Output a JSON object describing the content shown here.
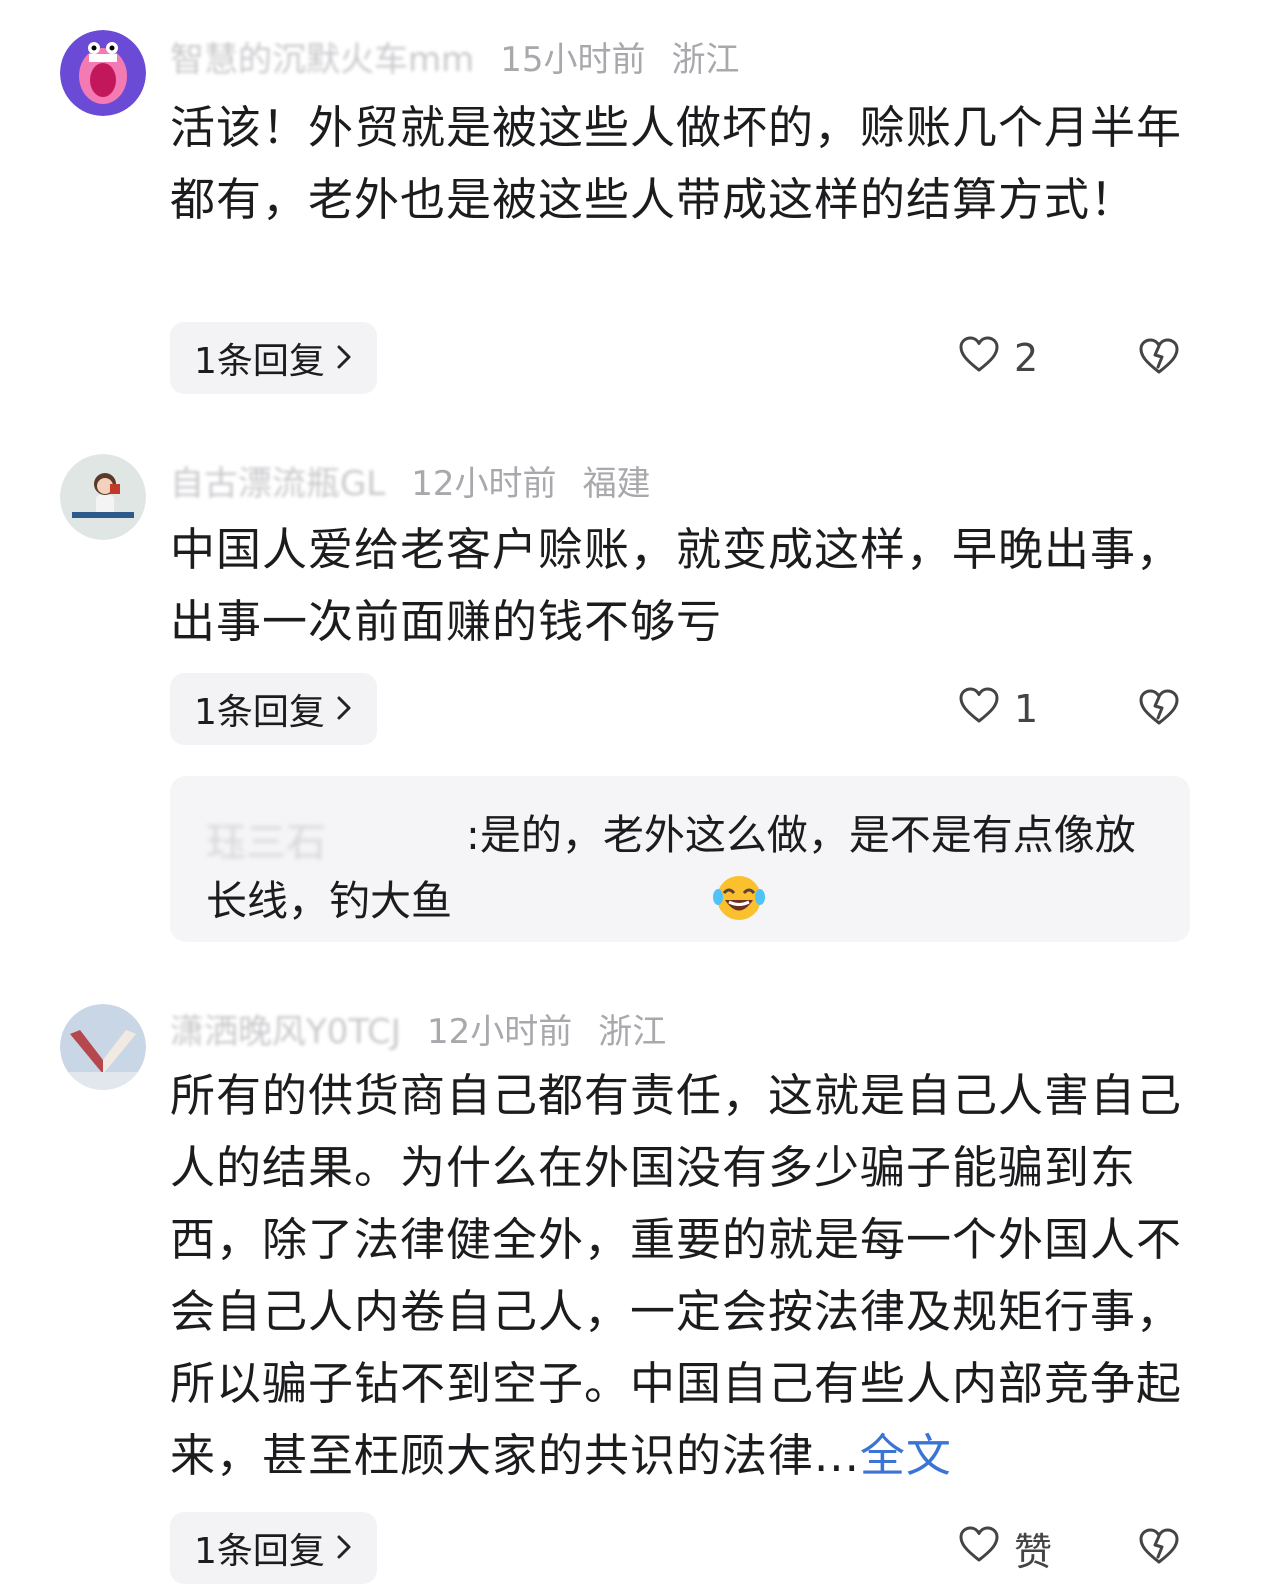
{
  "comments": [
    {
      "author": "智慧的沉默火车mm",
      "time": "15小时前",
      "location": "浙江",
      "text": "活该！外贸就是被这些人做坏的，赊账几个月半年都有，老外也是被这些人带成这样的结算方式！",
      "reply_label": "1条回复",
      "likes": "2"
    },
    {
      "author": "自古漂流瓶GL",
      "time": "12小时前",
      "location": "福建",
      "text": "中国人爱给老客户赊账，就变成这样，早晚出事，出事一次前面赚的钱不够亏",
      "reply_label": "1条回复",
      "likes": "1",
      "sub_reply": {
        "author": "珏三石",
        "text": ":是的，老外这么做，是不是有点像放长线，钓大鱼"
      }
    },
    {
      "author": "潇洒晚风Y0TCJ",
      "time": "12小时前",
      "location": "浙江",
      "text": "所有的供货商自己都有责任，这就是自己人害自己人的结果。为什么在外国没有多少骗子能骗到东西，除了法律健全外，重要的就是每一个外国人不会自己人内卷自己人，一定会按法律及规矩行事，所以骗子钻不到空子。中国自己有些人内部竞争起来，甚至枉顾大家的共识的法律...",
      "full_text_label": "全文",
      "reply_label": "1条回复",
      "likes": "赞"
    }
  ],
  "icons": {
    "like": "heart-outline-icon",
    "dislike": "broken-heart-icon",
    "chevron": "chevron-right-icon",
    "emoji": "laughing-tears-emoji"
  },
  "colors": {
    "meta": "#a8a8ad",
    "link": "#3a74d4",
    "pill_bg": "#f3f3f5"
  }
}
